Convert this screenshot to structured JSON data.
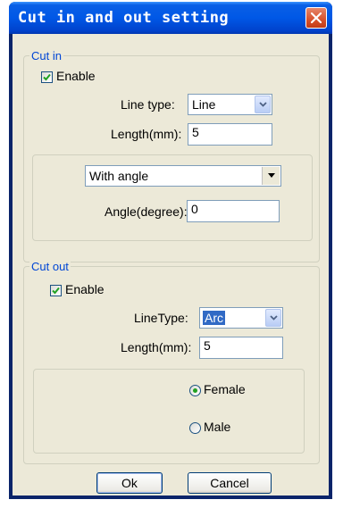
{
  "dialog": {
    "title": "Cut in and out setting"
  },
  "cut_in": {
    "legend": "Cut in",
    "enable_label": "Enable",
    "enable_checked": true,
    "line_type_label": "Line type:",
    "line_type_value": "Line",
    "length_label": "Length(mm):",
    "length_value": "5",
    "angle_mode_value": "With angle",
    "angle_label": "Angle(degree):",
    "angle_value": "0"
  },
  "cut_out": {
    "legend": "Cut out",
    "enable_label": "Enable",
    "enable_checked": true,
    "line_type_label": "LineType:",
    "line_type_value": "Arc",
    "length_label": "Length(mm):",
    "length_value": "5",
    "gender_options": [
      "Female",
      "Male"
    ],
    "gender_selected": "Female"
  },
  "buttons": {
    "ok": "Ok",
    "cancel": "Cancel"
  },
  "colors": {
    "title_bar": "#0058e6",
    "group_legend": "#0046d5",
    "dialog_bg": "#ece9d8",
    "close_button": "#d8512c"
  }
}
